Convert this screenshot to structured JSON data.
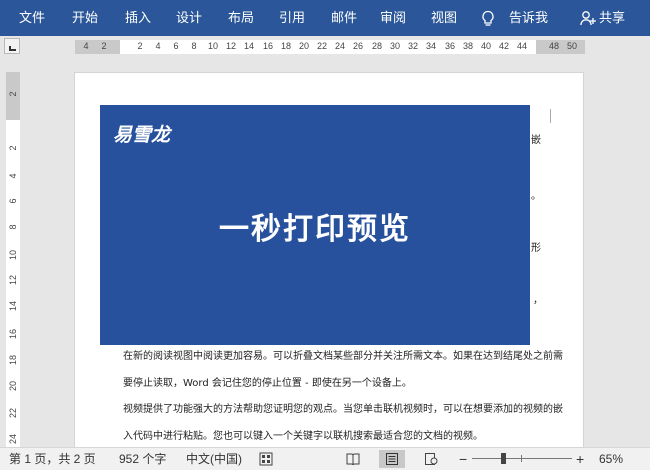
{
  "ribbon": {
    "tabs": [
      "文件",
      "开始",
      "插入",
      "设计",
      "布局",
      "引用",
      "邮件",
      "审阅",
      "视图"
    ],
    "tell_me": "告诉我",
    "share": "共享",
    "color": "#2b579a"
  },
  "ruler": {
    "h_numbers": [
      "4",
      "2",
      "2",
      "4",
      "6",
      "8",
      "10",
      "12",
      "14",
      "16",
      "18",
      "20",
      "22",
      "24",
      "26",
      "28",
      "30",
      "32",
      "34",
      "36",
      "38",
      "40",
      "42",
      "44",
      "48",
      "50"
    ],
    "v_numbers": [
      "2",
      "2",
      "4",
      "6",
      "8",
      "10",
      "12",
      "14",
      "16",
      "18",
      "20",
      "22",
      "24"
    ]
  },
  "document": {
    "visible_lines": [
      "在新的阅读视图中阅读更加容易。可以折叠文档某些部分并关注所需文本。如果在达到结尾处之前需",
      "要停止读取，Word 会记住您的停止位置 - 即使在另一个设备上。",
      "视频提供了功能强大的方法帮助您证明您的观点。当您单击联机视频时，可以在想要添加的视频的嵌",
      "入代码中进行粘贴。您也可以键入一个关键字以联机搜索最适合您的文档的视频。"
    ],
    "right_fragments": [
      "嵌",
      "。",
      "形",
      "，"
    ]
  },
  "banner": {
    "logo": "易雪龙",
    "headline": "一秒打印预览",
    "color": "#27519c"
  },
  "statusbar": {
    "page_info": "第 1 页，共 2 页",
    "word_count": "952 个字",
    "language": "中文(中国)",
    "zoom_minus": "−",
    "zoom_plus": "+",
    "zoom_level": "65%"
  }
}
